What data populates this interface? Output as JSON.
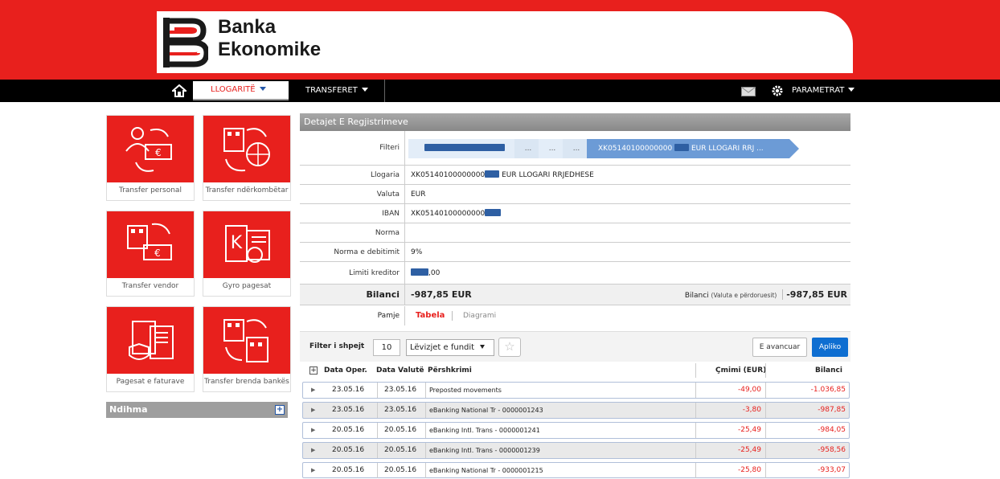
{
  "brand": {
    "line1": "Banka",
    "line2": "Ekonomike"
  },
  "nav": {
    "accounts": "LLOGARITË",
    "transfers": "TRANSFERET",
    "settings": "PARAMETRAT"
  },
  "tiles": [
    {
      "label": "Transfer personal",
      "icon": "personal-transfer-icon"
    },
    {
      "label": "Transfer ndërkombëtar",
      "icon": "international-transfer-icon"
    },
    {
      "label": "Transfer vendor",
      "icon": "domestic-transfer-icon"
    },
    {
      "label": "Gyro pagesat",
      "icon": "gyro-payment-icon"
    },
    {
      "label": "Pagesat e faturave",
      "icon": "bill-payment-icon"
    },
    {
      "label": "Transfer brenda bankës",
      "icon": "internal-transfer-icon"
    }
  ],
  "help": {
    "label": "Ndihma"
  },
  "panel": {
    "title": "Detajet E Regjistrimeve"
  },
  "filter": {
    "label": "Filteri",
    "dots": [
      "...",
      "...",
      "..."
    ],
    "last_prefix": "XK05140100000000",
    "last_suffix": "EUR LLOGARI RRJ ..."
  },
  "details": {
    "account_label": "Llogaria",
    "account_prefix": "XK05140100000000",
    "account_suffix": "EUR LLOGARI RRJEDHESE",
    "currency_label": "Valuta",
    "currency": "EUR",
    "iban_label": "IBAN",
    "iban_prefix": "XK05140100000000",
    "rate_label": "Norma",
    "debit_rate_label": "Norma e debitimit",
    "debit_rate": "9%",
    "credit_limit_label": "Limiti kreditor",
    "credit_limit_suffix": ",00",
    "balance_label": "Bilanci",
    "balance": "-987,85 EUR",
    "balance_user_label": "Bilanci",
    "balance_user_note": "(Valuta e përdoruesit)",
    "balance_user": "-987,85 EUR"
  },
  "view": {
    "label": "Pamje",
    "table_tab": "Tabela",
    "chart_tab": "Diagrami"
  },
  "quick_filter": {
    "label": "Filter i shpejt",
    "count": "10",
    "select": "Lëvizjet e fundit",
    "advanced": "E avancuar",
    "apply": "Apliko"
  },
  "table": {
    "columns": [
      "Data Oper.",
      "Data Valutë",
      "Përshkrimi",
      "Çmimi (EUR)",
      "Bilanci"
    ],
    "rows": [
      {
        "op": "23.05.16",
        "val": "23.05.16",
        "desc": "Preposted movements",
        "price": "-49,00",
        "balance": "-1.036,85"
      },
      {
        "op": "23.05.16",
        "val": "23.05.16",
        "desc": "eBanking National Tr - 0000001243",
        "price": "-3,80",
        "balance": "-987,85"
      },
      {
        "op": "20.05.16",
        "val": "20.05.16",
        "desc": "eBanking Intl. Trans - 0000001241",
        "price": "-25,49",
        "balance": "-984,05"
      },
      {
        "op": "20.05.16",
        "val": "20.05.16",
        "desc": "eBanking Intl. Trans - 0000001239",
        "price": "-25,49",
        "balance": "-958,56"
      },
      {
        "op": "20.05.16",
        "val": "20.05.16",
        "desc": "eBanking National Tr - 0000001215",
        "price": "-25,80",
        "balance": "-933,07"
      }
    ]
  }
}
